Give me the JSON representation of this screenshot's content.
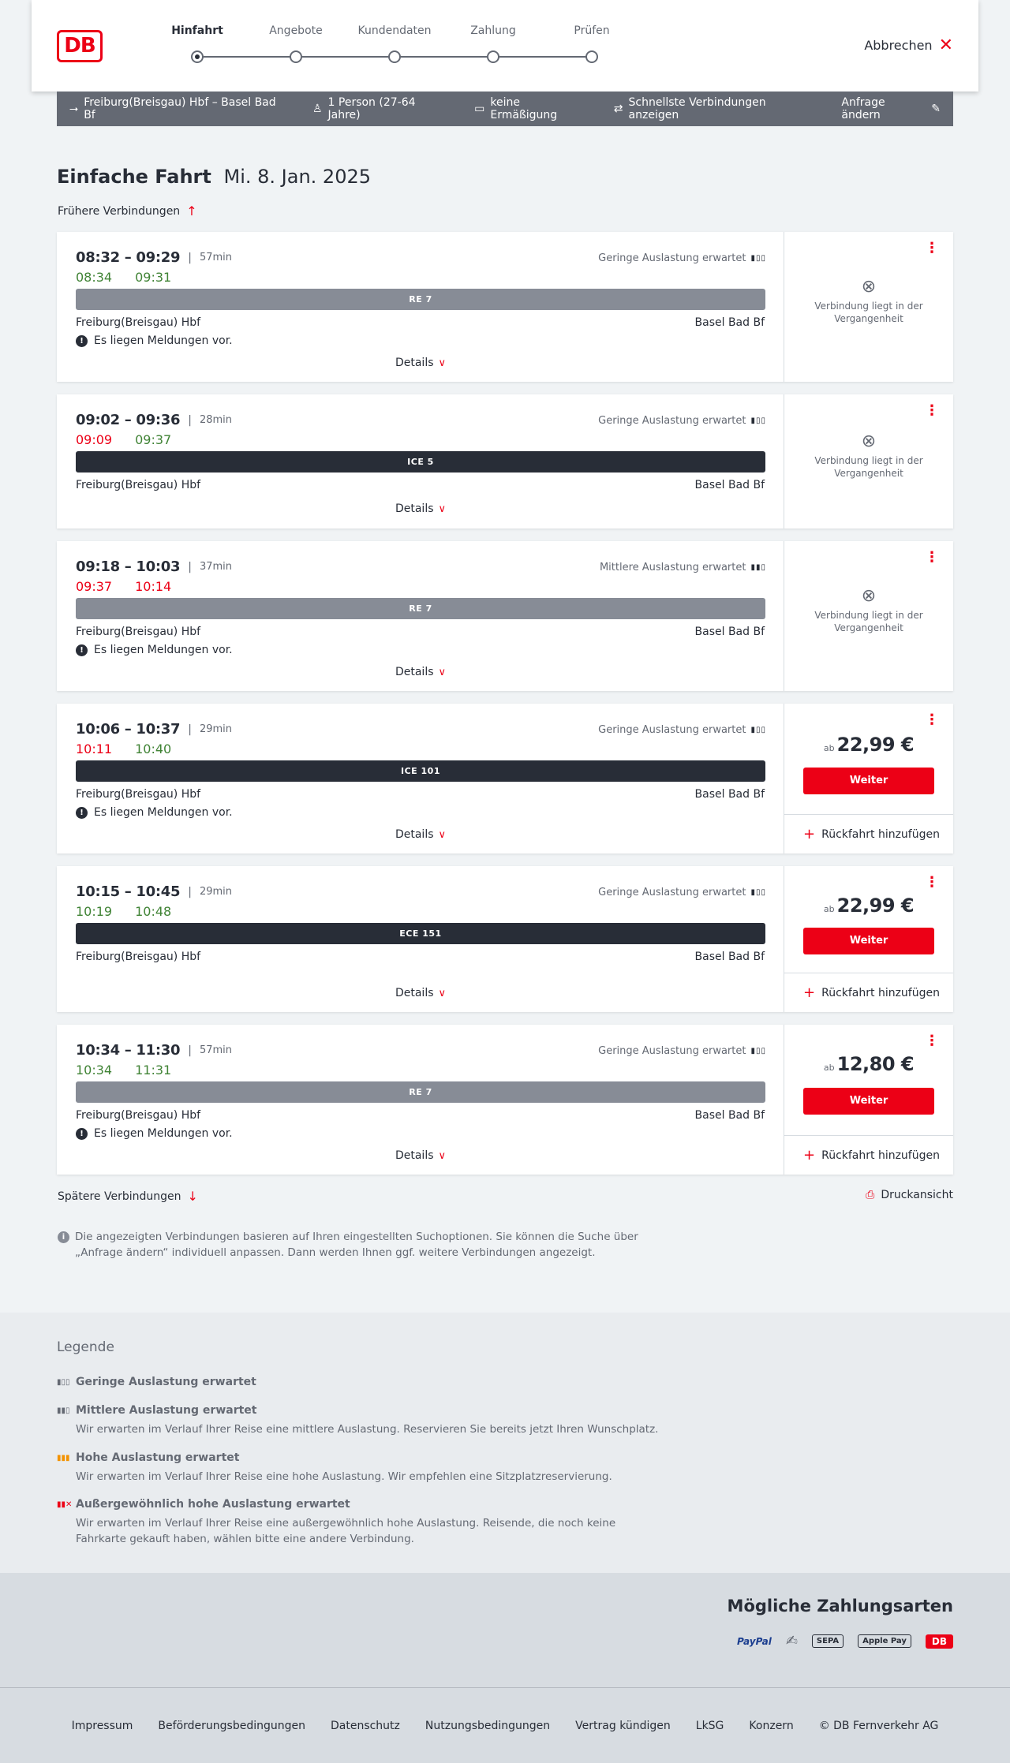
{
  "header": {
    "steps": [
      {
        "label": "Hinfahrt"
      },
      {
        "label": "Angebote"
      },
      {
        "label": "Kundendaten"
      },
      {
        "label": "Zahlung"
      },
      {
        "label": "Prüfen"
      }
    ],
    "active_step": 0,
    "cancel_label": "Abbrechen",
    "logo_text": "DB"
  },
  "summary": {
    "route": "Freiburg(Breisgau) Hbf – Basel Bad Bf",
    "passengers": "1 Person (27-64 Jahre)",
    "discount": "keine Ermäßigung",
    "fastest": "Schnellste Verbindungen anzeigen",
    "change": "Anfrage ändern"
  },
  "title": {
    "type": "Einfache Fahrt",
    "date": "Mi. 8. Jan. 2025"
  },
  "earlier_label": "Frühere Verbindungen",
  "later_label": "Spätere Verbindungen",
  "print_label": "Druckansicht",
  "connections": [
    {
      "times": "08:32 – 09:29",
      "duration": "57min",
      "rt_dep": "08:34",
      "rt_arr": "09:31",
      "dep_color": "green",
      "arr_color": "green",
      "load": "Geringe Auslastung erwartet",
      "train": "RE 7",
      "train_type": "re",
      "from": "Freiburg(Breisgau) Hbf",
      "to": "Basel Bad Bf",
      "message": "Es liegen Meldungen vor.",
      "details": "Details",
      "state": "past",
      "past_text": "Verbindung liegt in der Vergangenheit"
    },
    {
      "times": "09:02 – 09:36",
      "duration": "28min",
      "rt_dep": "09:09",
      "rt_arr": "09:37",
      "dep_color": "red",
      "arr_color": "green",
      "load": "Geringe Auslastung erwartet",
      "train": "ICE 5",
      "train_type": "ice",
      "from": "Freiburg(Breisgau) Hbf",
      "to": "Basel Bad Bf",
      "message": "",
      "details": "Details",
      "state": "past",
      "past_text": "Verbindung liegt in der Vergangenheit"
    },
    {
      "times": "09:18 – 10:03",
      "duration": "37min",
      "rt_dep": "09:37",
      "rt_arr": "10:14",
      "dep_color": "red",
      "arr_color": "red",
      "load": "Mittlere Auslastung erwartet",
      "train": "RE 7",
      "train_type": "re",
      "from": "Freiburg(Breisgau) Hbf",
      "to": "Basel Bad Bf",
      "message": "Es liegen Meldungen vor.",
      "details": "Details",
      "state": "past",
      "past_text": "Verbindung liegt in der Vergangenheit"
    },
    {
      "times": "10:06 – 10:37",
      "duration": "29min",
      "rt_dep": "10:11",
      "rt_arr": "10:40",
      "dep_color": "red",
      "arr_color": "green",
      "load": "Geringe Auslastung erwartet",
      "train": "ICE 101",
      "train_type": "ice",
      "from": "Freiburg(Breisgau) Hbf",
      "to": "Basel Bad Bf",
      "message": "Es liegen Meldungen vor.",
      "details": "Details",
      "state": "bookable",
      "price_prefix": "ab",
      "price": "22,99 €",
      "button": "Weiter",
      "return": "Rückfahrt hinzufügen"
    },
    {
      "times": "10:15 – 10:45",
      "duration": "29min",
      "rt_dep": "10:19",
      "rt_arr": "10:48",
      "dep_color": "green",
      "arr_color": "green",
      "load": "Geringe Auslastung erwartet",
      "train": "ECE 151",
      "train_type": "ice",
      "from": "Freiburg(Breisgau) Hbf",
      "to": "Basel Bad Bf",
      "message": "",
      "details": "Details",
      "state": "bookable",
      "price_prefix": "ab",
      "price": "22,99 €",
      "button": "Weiter",
      "return": "Rückfahrt hinzufügen"
    },
    {
      "times": "10:34 – 11:30",
      "duration": "57min",
      "rt_dep": "10:34",
      "rt_arr": "11:31",
      "dep_color": "green",
      "arr_color": "green",
      "load": "Geringe Auslastung erwartet",
      "train": "RE 7",
      "train_type": "re",
      "from": "Freiburg(Breisgau) Hbf",
      "to": "Basel Bad Bf",
      "message": "Es liegen Meldungen vor.",
      "details": "Details",
      "state": "bookable",
      "price_prefix": "ab",
      "price": "12,80 €",
      "button": "Weiter",
      "return": "Rückfahrt hinzufügen"
    }
  ],
  "info_note": "Die angezeigten Verbindungen basieren auf Ihren eingestellten Suchoptionen. Sie können die Suche über „Anfrage ändern“ individuell anpassen. Dann werden Ihnen ggf. weitere Verbindungen angezeigt.",
  "legend": {
    "title": "Legende",
    "items": [
      {
        "title": "Geringe Auslastung erwartet",
        "desc": ""
      },
      {
        "title": "Mittlere Auslastung erwartet",
        "desc": "Wir erwarten im Verlauf Ihrer Reise eine mittlere Auslastung. Reservieren Sie bereits jetzt Ihren Wunschplatz."
      },
      {
        "title": "Hohe Auslastung erwartet",
        "desc": "Wir erwarten im Verlauf Ihrer Reise eine hohe Auslastung. Wir empfehlen eine Sitzplatzreservierung."
      },
      {
        "title": "Außergewöhnlich hohe Auslastung erwartet",
        "desc": "Wir erwarten im Verlauf Ihrer Reise eine außergewöhnlich hohe Auslastung. Reisende, die noch keine Fahrkarte gekauft haben, wählen bitte eine andere Verbindung."
      }
    ]
  },
  "payment": {
    "title": "Mögliche Zahlungsarten",
    "methods": [
      "PayPal",
      "SEPA",
      "Apple Pay",
      "DB"
    ]
  },
  "footer": {
    "links": [
      "Impressum",
      "Beförderungsbedingungen",
      "Datenschutz",
      "Nutzungsbedingungen",
      "Vertrag kündigen",
      "LkSG",
      "Konzern",
      "© DB Fernverkehr AG"
    ]
  },
  "colors": {
    "brand": "#ec0016",
    "delay": "#ec0016",
    "ontime": "#408335"
  }
}
